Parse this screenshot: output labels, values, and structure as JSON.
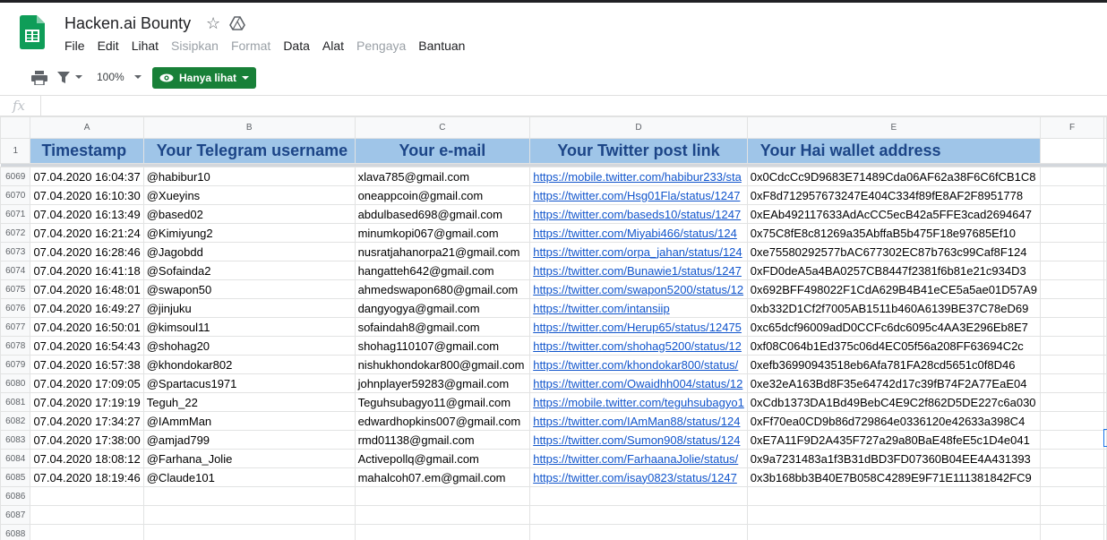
{
  "app": {
    "doc_title": "Hacken.ai Bounty",
    "menu": [
      {
        "label": "File",
        "enabled": true
      },
      {
        "label": "Edit",
        "enabled": true
      },
      {
        "label": "Lihat",
        "enabled": true
      },
      {
        "label": "Sisipkan",
        "enabled": false
      },
      {
        "label": "Format",
        "enabled": false
      },
      {
        "label": "Data",
        "enabled": true
      },
      {
        "label": "Alat",
        "enabled": true
      },
      {
        "label": "Pengaya",
        "enabled": false
      },
      {
        "label": "Bantuan",
        "enabled": true
      }
    ],
    "icons": {
      "star": "star-icon",
      "drive": "drive-icon",
      "print": "print-icon",
      "filter": "filter-icon",
      "view": "eye-icon"
    }
  },
  "toolbar": {
    "zoom": "100%",
    "view_mode": "Hanya lihat",
    "accent": "#188038"
  },
  "formula_bar": {
    "fx": "fx"
  },
  "sheet": {
    "columns": [
      "A",
      "B",
      "C",
      "D",
      "E",
      "F"
    ],
    "header_row_number": "1",
    "headers": [
      "Timestamp",
      "Your Telegram username",
      "Your e-mail",
      "Your Twitter post link",
      "Your Hai wallet address",
      ""
    ],
    "header_bg": "#9fc5e8",
    "header_color": "#1c4587",
    "link_color": "#1155cc",
    "rows": [
      {
        "n": "6069",
        "c": [
          "07.04.2020 16:04:37",
          "@habibur10",
          "xlava785@gmail.com",
          "https://mobile.twitter.com/habibur233/sta",
          "0x0CdcCc9D9683E71489Cda06AF62a38F6C6fCB1C8",
          ""
        ]
      },
      {
        "n": "6070",
        "c": [
          "07.04.2020 16:10:30",
          "@Xueyins",
          "oneappcoin@gmail.com",
          "https://twitter.com/Hsg01Fla/status/1247",
          "0xF8d712957673247E404C334f89fE8AF2F8951778",
          ""
        ]
      },
      {
        "n": "6071",
        "c": [
          "07.04.2020 16:13:49",
          "@based02",
          "abdulbased698@gmail.com",
          "https://twitter.com/baseds10/status/1247",
          "0xEAb492117633AdAcCC5ecB42a5FFE3cad2694647",
          ""
        ]
      },
      {
        "n": "6072",
        "c": [
          "07.04.2020 16:21:24",
          "@Kimiyung2",
          "minumkopi067@gmail.com",
          "https://twitter.com/Miyabi466/status/124",
          "0x75C8fE8c81269a35AbffaB5b475F18e97685Ef10",
          ""
        ]
      },
      {
        "n": "6073",
        "c": [
          "07.04.2020 16:28:46",
          "@Jagobdd",
          "nusratjahanorpa21@gmail.com",
          "https://twitter.com/orpa_jahan/status/124",
          "0xe75580292577bAC677302EC87b763c99Caf8F124",
          ""
        ]
      },
      {
        "n": "6074",
        "c": [
          "07.04.2020 16:41:18",
          "@Sofainda2",
          "hangatteh642@gmail.com",
          "https://twitter.com/Bunawie1/status/1247",
          "0xFD0deA5a4BA0257CB8447f2381f6b81e21c934D3",
          ""
        ]
      },
      {
        "n": "6075",
        "c": [
          "07.04.2020 16:48:01",
          "@swapon50",
          "ahmedswapon680@gmail.com",
          "https://twitter.com/swapon5200/status/12",
          "0x692BFF498022F1CdA629B4B41eCE5a5ae01D57A9",
          ""
        ]
      },
      {
        "n": "6076",
        "c": [
          "07.04.2020 16:49:27",
          "@jinjuku",
          "dangyogya@gmail.com",
          "https://twitter.com/intansiip",
          "0xb332D1Cf2f7005AB1511b460A6139BE37C78eD69",
          ""
        ]
      },
      {
        "n": "6077",
        "c": [
          "07.04.2020 16:50:01",
          "@kimsoul11",
          "sofaindah8@gmail.com",
          "https://twitter.com/Herup65/status/12475",
          "0xc65dcf96009adD0CCFc6dc6095c4AA3E296Eb8E7",
          ""
        ]
      },
      {
        "n": "6078",
        "c": [
          "07.04.2020 16:54:43",
          "@shohag20",
          "shohag110107@gmail.com",
          "https://twitter.com/shohag5200/status/12",
          "0xf08C064b1Ed375c06d4EC05f56a208FF63694C2c",
          ""
        ]
      },
      {
        "n": "6079",
        "c": [
          "07.04.2020 16:57:38",
          "@khondokar802",
          "nishukhondokar800@gmail.com",
          "https://twitter.com/khondokar800/status/",
          "0xefb36990943518eb6Afa781FA28cd5651c0f8D46",
          ""
        ]
      },
      {
        "n": "6080",
        "c": [
          "07.04.2020 17:09:05",
          "@Spartacus1971",
          "johnplayer59283@gmail.com",
          "https://twitter.com/Owaidhh004/status/12",
          "0xe32eA163Bd8F35e64742d17c39fB74F2A77EaE04",
          ""
        ]
      },
      {
        "n": "6081",
        "c": [
          "07.04.2020 17:19:19",
          "Teguh_22",
          "Teguhsubagyo11@gmail.com",
          "https://mobile.twitter.com/teguhsubagyo1",
          "0xCdb1373DA1Bd49BebC4E9C2f862D5DE227c6a030",
          ""
        ]
      },
      {
        "n": "6082",
        "c": [
          "07.04.2020 17:34:27",
          "@IAmmMan",
          "edwardhopkins007@gmail.com",
          "https://twitter.com/IAmMan88/status/124",
          "0xFf70ea0CD9b86d729864e0336120e42633a398C4",
          ""
        ]
      },
      {
        "n": "6083",
        "c": [
          "07.04.2020 17:38:00",
          "@amjad799",
          "rmd01138@gmail.com",
          "https://twitter.com/Sumon908/status/124",
          "0xE7A11F9D2A435F727a29a80BaE48feE5c1D4e041",
          ""
        ]
      },
      {
        "n": "6084",
        "c": [
          "07.04.2020 18:08:12",
          "@Farhana_Jolie",
          "Activepollq@gmail.com",
          "https://twitter.com/FarhaanaJolie/status/",
          "0x9a7231483a1f3B31dBD3FD07360B04EE4A431393",
          ""
        ]
      },
      {
        "n": "6085",
        "c": [
          "07.04.2020 18:19:46",
          "@Claude101",
          "mahalcoh07.em@gmail.com",
          "https://twitter.com/isay0823/status/1247",
          "0x3b168bb3B40E7B058C4289E9F71E111381842FC9",
          ""
        ]
      },
      {
        "n": "6086",
        "c": [
          "",
          "",
          "",
          "",
          "",
          ""
        ]
      },
      {
        "n": "6087",
        "c": [
          "",
          "",
          "",
          "",
          "",
          ""
        ]
      },
      {
        "n": "6088",
        "c": [
          "",
          "",
          "",
          "",
          "",
          ""
        ]
      }
    ]
  }
}
